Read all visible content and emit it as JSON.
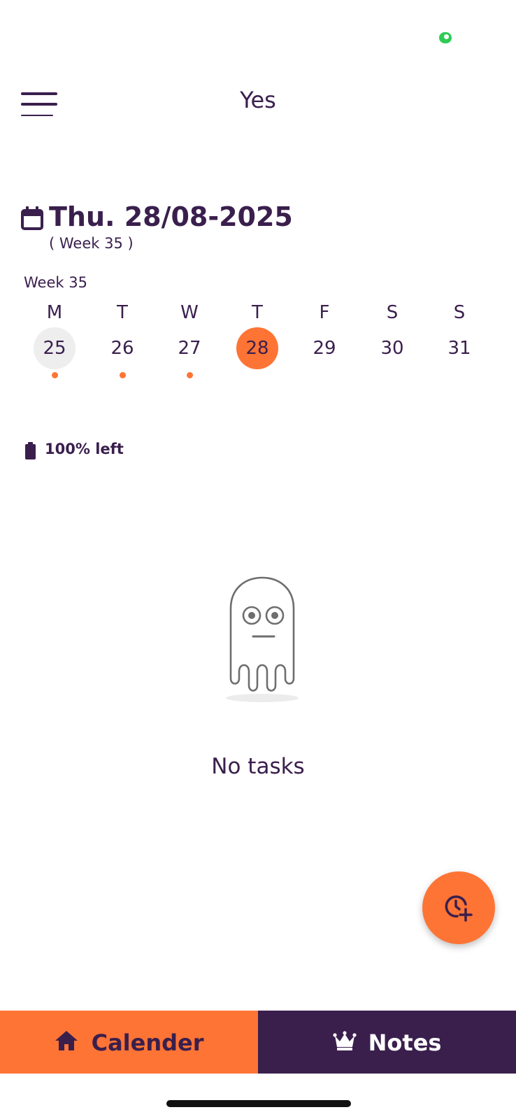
{
  "header": {
    "title": "Yes"
  },
  "date_block": {
    "date": "Thu. 28/08-2025",
    "week_sub": "( Week 35 )"
  },
  "week_strip": {
    "label": "Week 35",
    "days": [
      {
        "letter": "M",
        "number": "25",
        "state": "today",
        "has_task": true
      },
      {
        "letter": "T",
        "number": "26",
        "state": "normal",
        "has_task": true
      },
      {
        "letter": "W",
        "number": "27",
        "state": "normal",
        "has_task": true
      },
      {
        "letter": "T",
        "number": "28",
        "state": "selected",
        "has_task": false
      },
      {
        "letter": "F",
        "number": "29",
        "state": "normal",
        "has_task": false
      },
      {
        "letter": "S",
        "number": "30",
        "state": "normal",
        "has_task": false
      },
      {
        "letter": "S",
        "number": "31",
        "state": "normal",
        "has_task": false
      }
    ]
  },
  "battery": {
    "text": "100% left",
    "icon": "battery-full-icon"
  },
  "empty_state": {
    "illustration": "ghost-icon",
    "message": "No tasks"
  },
  "fab": {
    "icon": "clock-plus-icon"
  },
  "bottom_nav": {
    "tabs": [
      {
        "label": "Calender",
        "icon": "home-icon",
        "active": true
      },
      {
        "label": "Notes",
        "icon": "crown-icon",
        "active": false
      }
    ]
  },
  "colors": {
    "accent": "#fe7435",
    "primary": "#3a1f4d",
    "today_bg": "#eeeeee",
    "status_green": "#2ecc55"
  }
}
